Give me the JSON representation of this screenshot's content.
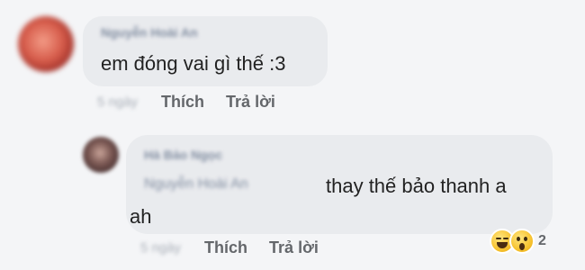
{
  "comment": {
    "author": "Nguyễn Hoài An",
    "text": "em đóng vai gì thế :3",
    "time": "5 ngày",
    "like_label": "Thích",
    "reply_label": "Trả lời"
  },
  "reply": {
    "author": "Hà Bảo Ngọc",
    "mention": "Nguyễn Hoài An",
    "text_line1": "thay thế bảo thanh a",
    "text_line2": "ah",
    "time": "5 ngày",
    "like_label": "Thích",
    "reply_label": "Trả lời",
    "reactions": {
      "icons": [
        "haha-reaction-icon",
        "wow-reaction-icon"
      ],
      "count": "2"
    }
  }
}
